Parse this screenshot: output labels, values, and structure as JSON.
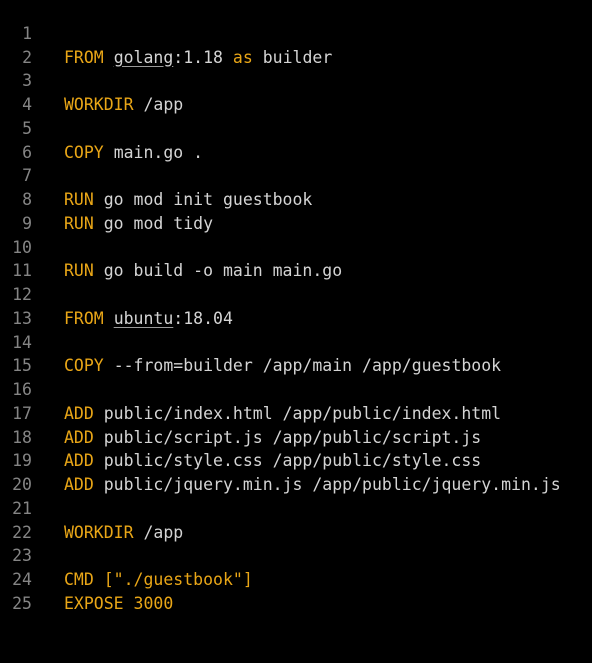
{
  "theme": {
    "background": "#000000",
    "keyword_color": "#e9a617",
    "text_color": "#d4d4d4",
    "line_number_color": "#858585"
  },
  "lines": [
    {
      "n": "1",
      "kw": "FROM",
      "text": "golang:1.18 as builder"
    },
    {
      "n": "2",
      "kw": "",
      "text": ""
    },
    {
      "n": "3",
      "kw": "WORKDIR",
      "text": "/app"
    },
    {
      "n": "4",
      "kw": "",
      "text": ""
    },
    {
      "n": "5",
      "kw": "COPY",
      "text": "main.go ."
    },
    {
      "n": "6",
      "kw": "",
      "text": ""
    },
    {
      "n": "7",
      "kw": "RUN",
      "text": "go mod init guestbook"
    },
    {
      "n": "8",
      "kw": "RUN",
      "text": "go mod tidy"
    },
    {
      "n": "9",
      "kw": "",
      "text": ""
    },
    {
      "n": "10",
      "kw": "RUN",
      "text": "go build -o main main.go"
    },
    {
      "n": "11",
      "kw": "",
      "text": ""
    },
    {
      "n": "12",
      "kw": "FROM",
      "text": "ubuntu:18.04"
    },
    {
      "n": "13",
      "kw": "",
      "text": ""
    },
    {
      "n": "14",
      "kw": "COPY",
      "text": "--from=builder /app/main /app/guestbook"
    },
    {
      "n": "15",
      "kw": "",
      "text": ""
    },
    {
      "n": "16",
      "kw": "ADD",
      "text": "public/index.html /app/public/index.html"
    },
    {
      "n": "17",
      "kw": "ADD",
      "text": "public/script.js /app/public/script.js"
    },
    {
      "n": "18",
      "kw": "ADD",
      "text": "public/style.css /app/public/style.css"
    },
    {
      "n": "19",
      "kw": "ADD",
      "text": "public/jquery.min.js /app/public/jquery.min.js"
    },
    {
      "n": "20",
      "kw": "",
      "text": ""
    },
    {
      "n": "21",
      "kw": "WORKDIR",
      "text": "/app"
    },
    {
      "n": "22",
      "kw": "",
      "text": ""
    },
    {
      "n": "23",
      "kw": "CMD",
      "text": "[\"./guestbook\"]"
    },
    {
      "n": "24",
      "kw": "EXPOSE",
      "text": "3000"
    },
    {
      "n": "25",
      "kw": "",
      "text": ""
    }
  ]
}
